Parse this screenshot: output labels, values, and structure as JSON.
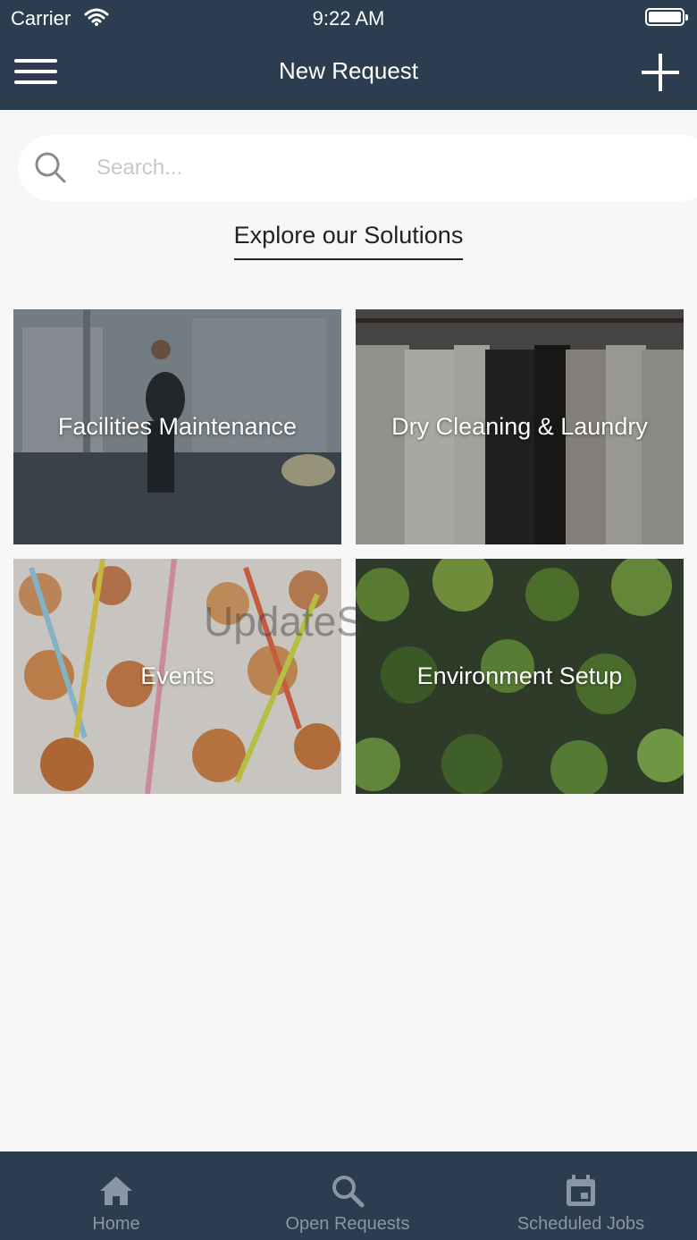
{
  "status_bar": {
    "carrier": "Carrier",
    "time": "9:22 AM"
  },
  "header": {
    "title": "New Request"
  },
  "search": {
    "placeholder": "Search..."
  },
  "section": {
    "title": "Explore our Solutions"
  },
  "solutions": [
    {
      "label": "Facilities Maintenance"
    },
    {
      "label": "Dry Cleaning & Laundry"
    },
    {
      "label": "Events"
    },
    {
      "label": "Environment Setup"
    }
  ],
  "watermark": "UpdateS",
  "tabs": [
    {
      "label": "Home",
      "icon": "home-icon"
    },
    {
      "label": "Open Requests",
      "icon": "search-icon"
    },
    {
      "label": "Scheduled Jobs",
      "icon": "calendar-icon"
    }
  ],
  "colors": {
    "header_bg": "#2b3d4f",
    "tabbar_bg": "#2b3d4f",
    "tab_inactive": "#8a96a3",
    "page_bg": "#f7f7f7"
  }
}
